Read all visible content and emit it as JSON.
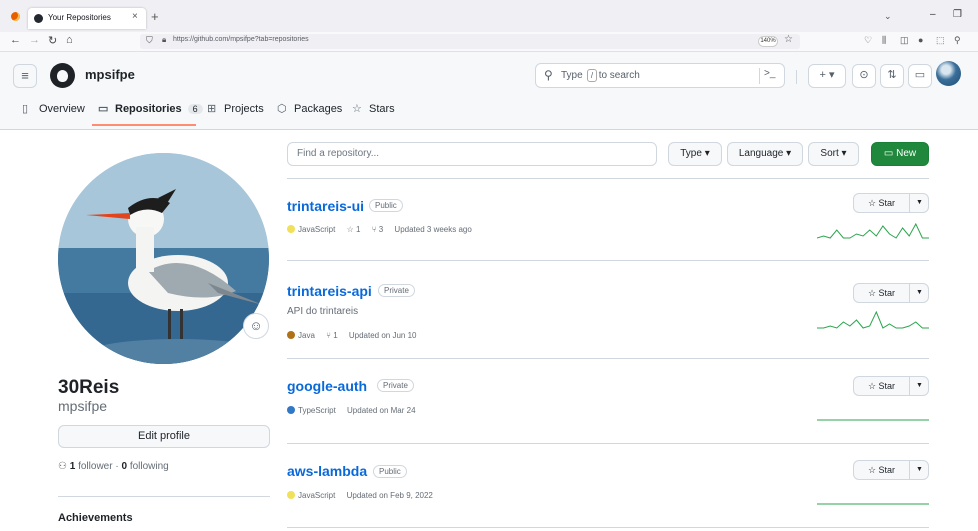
{
  "browser": {
    "tab_title": "Your Repositories",
    "tab_close": "×",
    "new_tab": "+",
    "tab_list": "⌄",
    "win_min": "–",
    "win_max": "❐",
    "url_text": "https://github.com/mpsifpe?tab=repositories",
    "zoom": "140%"
  },
  "header": {
    "username": "mpsifpe",
    "search_prefix": "Type",
    "search_key": "/",
    "search_suffix": "to search",
    "cmd_label": ">_",
    "create_label": "+ ▾"
  },
  "profile_tabs": [
    {
      "label": "Overview",
      "icon": "book-icon"
    },
    {
      "label": "Repositories",
      "icon": "repo-icon",
      "count": "6"
    },
    {
      "label": "Projects",
      "icon": "table-icon"
    },
    {
      "label": "Packages",
      "icon": "package-icon"
    },
    {
      "label": "Stars",
      "icon": "star-icon"
    }
  ],
  "sidebar": {
    "name": "30Reis",
    "login": "mpsifpe",
    "edit_profile": "Edit profile",
    "followers_count": "1",
    "followers_label": "follower",
    "separator": "·",
    "following_count": "0",
    "following_label": "following",
    "achievements": "Achievements"
  },
  "toolbar": {
    "search_placeholder": "Find a repository...",
    "type_label": "Type ▾",
    "language_label": "Language ▾",
    "sort_label": "Sort ▾",
    "new_label": "New"
  },
  "repos": [
    {
      "name": "trintareis-ui",
      "visibility": "Public",
      "description": "",
      "language": "JavaScript",
      "lang_color": "#f1e05a",
      "stars": "1",
      "forks": "3",
      "updated": "Updated 3 weeks ago",
      "star_label": "Star",
      "activity": [
        1,
        2,
        1,
        5,
        1,
        1,
        3,
        2,
        5,
        2,
        7,
        3,
        1,
        6,
        2,
        8,
        1,
        1
      ]
    },
    {
      "name": "trintareis-api",
      "visibility": "Private",
      "description": "API do trintareis",
      "language": "Java",
      "lang_color": "#b07219",
      "stars": "",
      "forks": "1",
      "updated": "Updated on Jun 10",
      "star_label": "Star",
      "activity": [
        1,
        1,
        2,
        1,
        4,
        2,
        5,
        1,
        2,
        9,
        1,
        3,
        1,
        1,
        2,
        4,
        1,
        1
      ]
    },
    {
      "name": "google-auth",
      "visibility": "Private",
      "description": "",
      "language": "TypeScript",
      "lang_color": "#3178c6",
      "stars": "",
      "forks": "",
      "updated": "Updated on Mar 24",
      "star_label": "Star",
      "activity": [
        0,
        0,
        0,
        0,
        0,
        0,
        0,
        0,
        0,
        0,
        0,
        0,
        0,
        0,
        0,
        0,
        0,
        0
      ]
    },
    {
      "name": "aws-lambda",
      "visibility": "Public",
      "description": "",
      "language": "JavaScript",
      "lang_color": "#f1e05a",
      "stars": "",
      "forks": "",
      "updated": "Updated on Feb 9, 2022",
      "star_label": "Star",
      "activity": [
        0,
        0,
        0,
        0,
        0,
        0,
        0,
        0,
        0,
        0,
        0,
        0,
        0,
        0,
        0,
        0,
        0,
        0
      ]
    }
  ],
  "colors": {
    "accent": "#0969da",
    "new_button": "#1f883d",
    "tab_underline": "#fd8c73",
    "sparkline": "#2da44e"
  }
}
